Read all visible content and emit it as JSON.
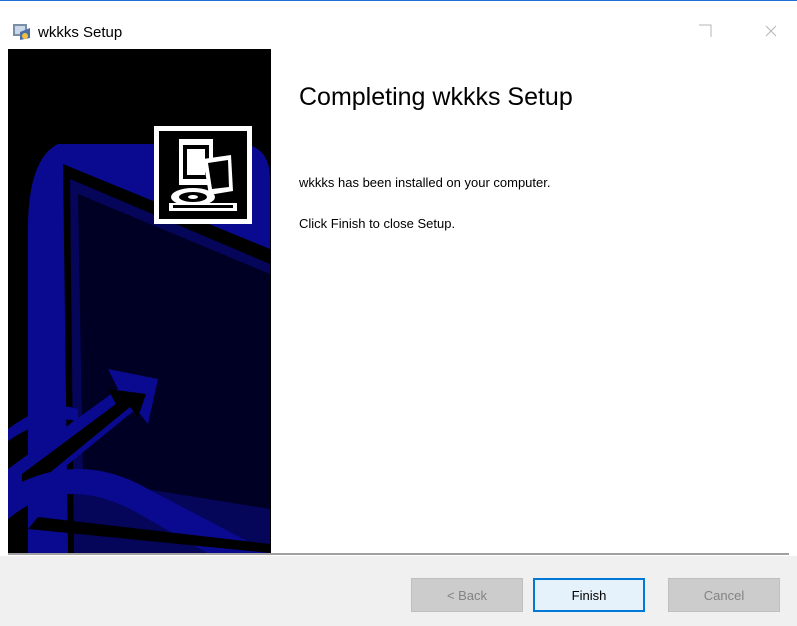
{
  "window": {
    "title": "wkkks Setup"
  },
  "content": {
    "heading": "Completing wkkks Setup",
    "installed_message": "wkkks has been installed on your computer.",
    "finish_instruction": "Click Finish to close Setup."
  },
  "buttons": {
    "back_label": "< Back",
    "finish_label": "Finish",
    "cancel_label": "Cancel"
  },
  "icons": {
    "app": "installer-icon",
    "maximize": "maximize-icon",
    "close": "close-icon",
    "logo": "computer-install-icon"
  },
  "colors": {
    "banner_bg": "#000000",
    "banner_shape": "#0a0a90",
    "accent": "#0078d7",
    "footer_bg": "#f0f0f0"
  }
}
